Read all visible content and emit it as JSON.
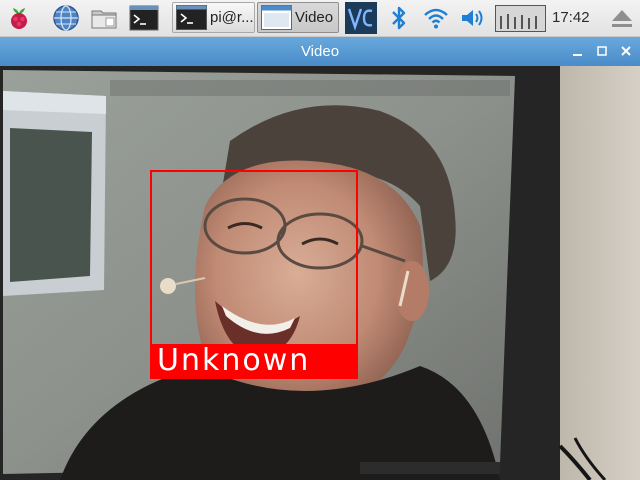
{
  "taskbar": {
    "launchers": [
      {
        "name": "raspberry-menu-icon"
      },
      {
        "name": "web-browser-icon"
      },
      {
        "name": "file-manager-icon"
      },
      {
        "name": "terminal-icon"
      }
    ],
    "tasks": [
      {
        "label": "pi@r...",
        "icon": "terminal-icon"
      },
      {
        "label": "Video",
        "icon": "window-icon",
        "active": true
      }
    ],
    "tray": {
      "icons": [
        "vnc-icon",
        "bluetooth-icon",
        "wifi-icon",
        "volume-icon",
        "cpu-monitor-icon",
        "eject-icon"
      ],
      "clock": "17:42"
    }
  },
  "window": {
    "title": "Video",
    "controls": [
      "minimize-icon",
      "maximize-icon",
      "close-icon"
    ]
  },
  "detection": {
    "label": "Unknown",
    "box_color": "#ff0000"
  }
}
